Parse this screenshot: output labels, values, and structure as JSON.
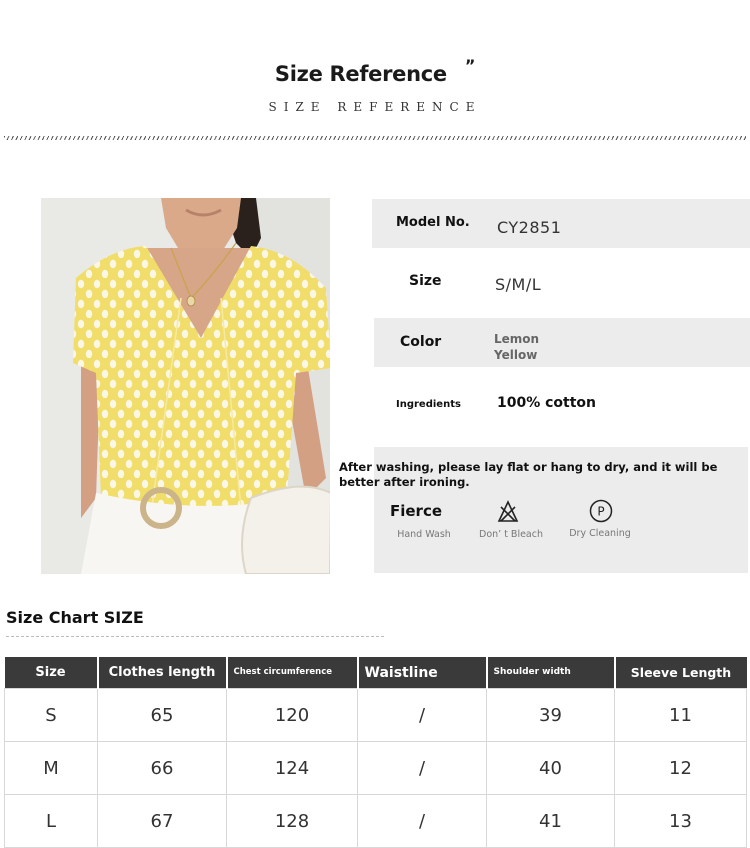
{
  "header": {
    "title": "Size Reference",
    "quote": "”",
    "subtitle": "SIZE REFERENCE"
  },
  "product": {
    "model_label": "Model No.",
    "model_value": "CY2851",
    "size_label": "Size",
    "size_value": "S/M/L",
    "color_label": "Color",
    "color_value_line1": "Lemon",
    "color_value_line2": "Yellow",
    "ingredients_label": "Ingredients",
    "ingredients_value": "100% cotton",
    "care_note": "After washing, please lay flat or hang to dry, and it will be better after ironing.",
    "care_label": "Fierce",
    "care_items": [
      "Hand Wash",
      "Don’ t Bleach",
      "Dry Cleaning"
    ]
  },
  "size_chart": {
    "title": "Size Chart SIZE",
    "headers": [
      "Size",
      "Clothes length",
      "Chest circumference",
      "Waistline",
      "Shoulder width",
      "Sleeve Length"
    ],
    "rows": [
      [
        "S",
        "65",
        "120",
        "/",
        "39",
        "11"
      ],
      [
        "M",
        "66",
        "124",
        "/",
        "40",
        "12"
      ],
      [
        "L",
        "67",
        "128",
        "/",
        "41",
        "13"
      ]
    ]
  },
  "colors": {
    "header_bg": "#3a3a3a",
    "panel_bg": "#ececec",
    "blouse": "#f3e27a"
  }
}
